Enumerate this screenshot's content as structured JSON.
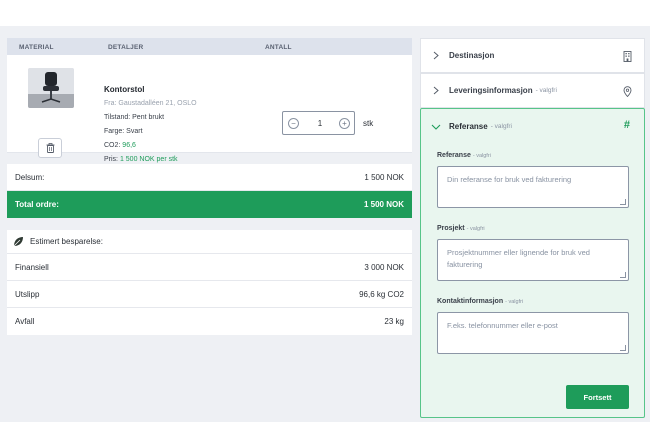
{
  "table": {
    "headers": {
      "material": "MATERIAL",
      "details": "DETALJER",
      "quantity": "ANTALL"
    }
  },
  "product": {
    "name": "Kontorstol",
    "from": "Fra: Gaustadalléen 21, OSLO",
    "condition": "Tilstand: Pent brukt",
    "color": "Farge: Svart",
    "co2_label": "CO2:",
    "co2_value": "96,6",
    "price_label": "Pris:",
    "price_value": "1 500 NOK per stk",
    "quantity": "1",
    "unit": "stk"
  },
  "summary": {
    "subtotal_label": "Delsum:",
    "subtotal_value": "1 500 NOK",
    "total_label": "Total ordre:",
    "total_value": "1 500 NOK"
  },
  "savings": {
    "title": "Estimert besparelse:",
    "rows": [
      {
        "label": "Finansiell",
        "value": "3 000 NOK"
      },
      {
        "label": "Utslipp",
        "value": "96,6 kg CO2"
      },
      {
        "label": "Avfall",
        "value": "23 kg"
      }
    ]
  },
  "accordion": {
    "destination": {
      "title": "Destinasjon"
    },
    "delivery": {
      "title": "Leveringsinformasjon",
      "optional": "- valgfri"
    },
    "reference": {
      "title": "Referanse",
      "optional": "- valgfri"
    }
  },
  "form": {
    "reference": {
      "label": "Referanse",
      "optional": "- valgfri",
      "placeholder": "Din referanse for bruk ved fakturering"
    },
    "project": {
      "label": "Prosjekt",
      "optional": "- valgfri",
      "placeholder": "Prosjektnummer eller lignende for bruk ved fakturering"
    },
    "contact": {
      "label": "Kontaktinformasjon",
      "optional": "- valgfri",
      "placeholder": "F.eks. telefonnummer eller e-post"
    },
    "submit_label": "Fortsett"
  },
  "colors": {
    "accent": "#1e9c5a",
    "panel_bg": "#e9f6ef",
    "header_bg": "#dde2ec"
  }
}
